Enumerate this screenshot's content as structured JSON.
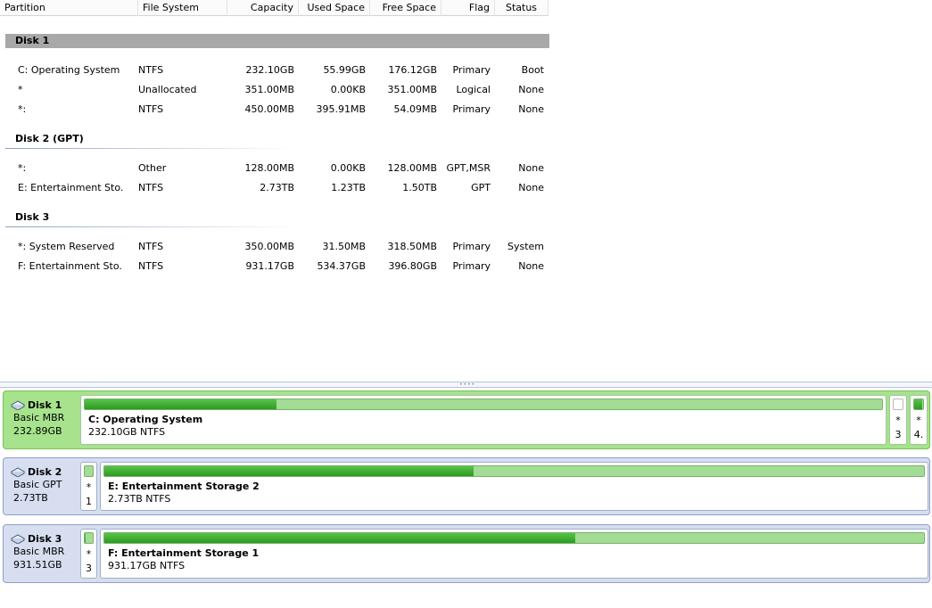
{
  "columns": {
    "partition": "Partition",
    "file_system": "File System",
    "capacity": "Capacity",
    "used_space": "Used Space",
    "free_space": "Free Space",
    "flag": "Flag",
    "status": "Status"
  },
  "disks": [
    {
      "title": "Disk 1",
      "rows": [
        {
          "partition": "C: Operating System",
          "fs": "NTFS",
          "capacity": "232.10GB",
          "used": "55.99GB",
          "free": "176.12GB",
          "flag": "Primary",
          "status": "Boot"
        },
        {
          "partition": "*",
          "fs": "Unallocated",
          "capacity": "351.00MB",
          "used": "0.00KB",
          "free": "351.00MB",
          "flag": "Logical",
          "status": "None"
        },
        {
          "partition": "*:",
          "fs": "NTFS",
          "capacity": "450.00MB",
          "used": "395.91MB",
          "free": "54.09MB",
          "flag": "Primary",
          "status": "None"
        }
      ]
    },
    {
      "title": "Disk 2 (GPT)",
      "rows": [
        {
          "partition": "*:",
          "fs": "Other",
          "capacity": "128.00MB",
          "used": "0.00KB",
          "free": "128.00MB",
          "flag": "GPT,MSR",
          "status": "None"
        },
        {
          "partition": "E: Entertainment Sto...",
          "fs": "NTFS",
          "capacity": "2.73TB",
          "used": "1.23TB",
          "free": "1.50TB",
          "flag": "GPT",
          "status": "None"
        }
      ]
    },
    {
      "title": "Disk 3",
      "rows": [
        {
          "partition": "*: System Reserved",
          "fs": "NTFS",
          "capacity": "350.00MB",
          "used": "31.50MB",
          "free": "318.50MB",
          "flag": "Primary",
          "status": "System"
        },
        {
          "partition": "F: Entertainment Sto...",
          "fs": "NTFS",
          "capacity": "931.17GB",
          "used": "534.37GB",
          "free": "396.80GB",
          "flag": "Primary",
          "status": "None"
        }
      ]
    }
  ],
  "disk_map": [
    {
      "name": "Disk 1",
      "type": "Basic MBR",
      "size": "232.89GB",
      "partitions": [
        {
          "name": "C: Operating System",
          "desc": "232.10GB NTFS",
          "used_fraction": 0.241
        },
        {
          "line1": "*",
          "line2": "3",
          "used_fraction": 0.0,
          "unallocated": true
        },
        {
          "line1": "*",
          "line2": "4.",
          "used_fraction": 0.88
        }
      ]
    },
    {
      "name": "Disk 2",
      "type": "Basic GPT",
      "size": "2.73TB",
      "partitions": [
        {
          "line1": "*",
          "line2": "1",
          "used_fraction": 0.0
        },
        {
          "name": "E: Entertainment Storage 2",
          "desc": "2.73TB NTFS",
          "used_fraction": 0.45
        }
      ]
    },
    {
      "name": "Disk 3",
      "type": "Basic MBR",
      "size": "931.51GB",
      "partitions": [
        {
          "line1": "*",
          "line2": "3",
          "used_fraction": 0.09
        },
        {
          "name": "F: Entertainment Storage 1",
          "desc": "931.17GB NTFS",
          "used_fraction": 0.574
        }
      ]
    }
  ],
  "colors": {
    "selected_disk_bg": "#a6e38c",
    "disk_bg": "#d6def0",
    "used_fill": "#2c9a22",
    "free_fill": "#a3dc94",
    "group_highlight": "#a8a8a8"
  }
}
